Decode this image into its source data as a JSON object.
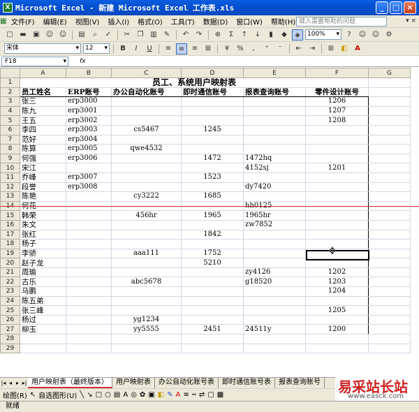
{
  "window": {
    "title": "Microsoft Excel - 新建 Microsoft Excel 工作表.xls",
    "app_icon": "X"
  },
  "menu": [
    "文件(F)",
    "编辑(E)",
    "视图(V)",
    "插入(I)",
    "格式(O)",
    "工具(T)",
    "数据(D)",
    "窗口(W)",
    "帮助(H)"
  ],
  "help_box": {
    "placeholder": "键入需要帮助的问题"
  },
  "toolbar": {
    "zoom": "100%",
    "font_name": "宋体",
    "font_size": "12",
    "bold": "B",
    "italic": "I",
    "underline": "U",
    "percent": "%"
  },
  "formula_bar": {
    "name_box": "F18",
    "fx": "fx"
  },
  "columns": [
    "A",
    "B",
    "C",
    "D",
    "E",
    "F",
    "G"
  ],
  "sheet": {
    "title": "员工、系统用户映射表",
    "headers": [
      "员工姓名",
      "ERP账号",
      "办公自动化账号",
      "即时通信账号",
      "报表查询账号",
      "零件设计账号"
    ],
    "rows": [
      [
        "张三",
        "erp3000",
        "",
        "",
        "",
        "1206"
      ],
      [
        "陈九",
        "erp3001",
        "",
        "",
        "",
        "1207"
      ],
      [
        "王五",
        "erp3002",
        "",
        "",
        "",
        "1208"
      ],
      [
        "李四",
        "erp3003",
        "cs5467",
        "1245",
        "",
        ""
      ],
      [
        "范好",
        "erp3004",
        "",
        "",
        "",
        ""
      ],
      [
        "陈算",
        "erp3005",
        "qwe4532",
        "",
        "",
        ""
      ],
      [
        "何强",
        "erp3006",
        "",
        "1472",
        "1472hq",
        ""
      ],
      [
        "宋江",
        "",
        "",
        "",
        "4152sj",
        "1201"
      ],
      [
        "乔峰",
        "erp3007",
        "",
        "1523",
        "",
        ""
      ],
      [
        "段誉",
        "erp3008",
        "",
        "",
        "dy7420",
        ""
      ],
      [
        "陈艳",
        "",
        "cy3222",
        "1685",
        "",
        ""
      ],
      [
        "何花",
        "",
        "",
        "",
        "hh0125",
        ""
      ],
      [
        "韩荣",
        "",
        "456hr",
        "1965",
        "1965hr",
        ""
      ],
      [
        "朱文",
        "",
        "",
        "",
        "zw7852",
        ""
      ],
      [
        "张红",
        "",
        "",
        "1842",
        "",
        ""
      ],
      [
        "杨子",
        "",
        "",
        "",
        "",
        ""
      ],
      [
        "李骄",
        "",
        "aaa111",
        "1752",
        "",
        ""
      ],
      [
        "赵子龙",
        "",
        "",
        "5210",
        "",
        ""
      ],
      [
        "周瑜",
        "",
        "",
        "",
        "zy4126",
        "1202"
      ],
      [
        "古乐",
        "",
        "abc5678",
        "",
        "g18520",
        "1203"
      ],
      [
        "马鹏",
        "",
        "",
        "",
        "",
        "1204"
      ],
      [
        "陈五弟",
        "",
        "",
        "",
        "",
        ""
      ],
      [
        "张三峰",
        "",
        "",
        "",
        "",
        "1205"
      ],
      [
        "杨过",
        "",
        "yg1234",
        "",
        "",
        ""
      ],
      [
        "柳玉",
        "",
        "yy5555",
        "2451",
        "24511y",
        "1200"
      ]
    ],
    "empty_rows": [
      28,
      29
    ]
  },
  "tabs": [
    "用户映射表（最终版本）",
    "用户映射表",
    "办公自动化账号表",
    "即时通信账号表",
    "报表查询账号"
  ],
  "drawing_toolbar": {
    "draw_label": "绘图(R)",
    "autoshape_label": "自选图形(U)"
  },
  "status": "就绪",
  "watermark": {
    "title": "易采站长站",
    "url": "www.easck.com"
  }
}
